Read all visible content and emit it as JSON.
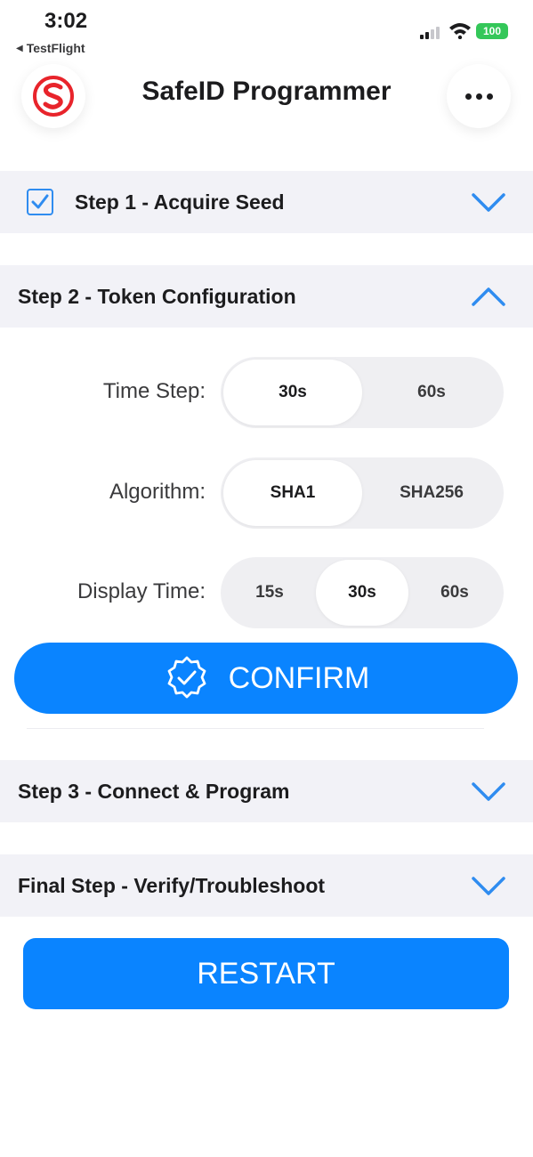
{
  "status_bar": {
    "time": "3:02",
    "back_app": "TestFlight",
    "battery": "100"
  },
  "header": {
    "title": "SafeID Programmer"
  },
  "steps": {
    "step1": {
      "label": "Step 1 - Acquire Seed",
      "checked": true,
      "expanded": false
    },
    "step2": {
      "label": "Step 2 - Token Configuration",
      "expanded": true
    },
    "step3": {
      "label": "Step 3 - Connect & Program",
      "expanded": false
    },
    "final": {
      "label": "Final Step - Verify/Troubleshoot",
      "expanded": false
    }
  },
  "config": {
    "time_step": {
      "label": "Time Step:",
      "options": [
        "30s",
        "60s"
      ],
      "selected": "30s"
    },
    "algorithm": {
      "label": "Algorithm:",
      "options": [
        "SHA1",
        "SHA256"
      ],
      "selected": "SHA1"
    },
    "display_time": {
      "label": "Display Time:",
      "options": [
        "15s",
        "30s",
        "60s"
      ],
      "selected": "30s"
    }
  },
  "buttons": {
    "confirm": "CONFIRM",
    "restart": "RESTART"
  },
  "colors": {
    "accent": "#0a84ff",
    "chevron": "#2f8cf0",
    "logo_red": "#e8242b",
    "section_bg": "#f2f2f7",
    "battery_green": "#34c759"
  },
  "icons": {
    "logo": "safeid-logo-icon",
    "more": "more-dots-icon",
    "chevron_down": "chevron-down-icon",
    "chevron_up": "chevron-up-icon",
    "confirm": "verified-badge-icon"
  }
}
